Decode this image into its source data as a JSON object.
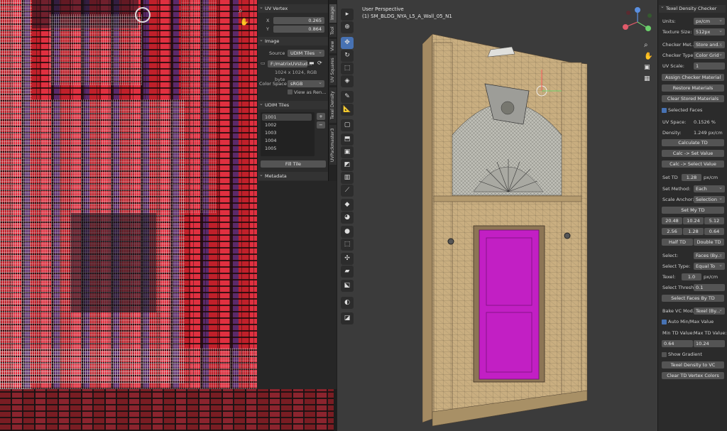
{
  "uv_editor": {
    "uv_vertex": {
      "title": "UV Vertex",
      "x_label": "X",
      "x_value": "0.265",
      "y_label": "Y",
      "y_value": "0.864"
    },
    "image": {
      "title": "Image",
      "source_label": "Source",
      "source_value": "UDIM Tiles",
      "filepath": "F:/matrixUVstud...",
      "info": "1024 x 1024,  RGB byte",
      "color_space_label": "Color Space",
      "color_space_value": "sRGB",
      "view_as_render": "View as Ren..."
    },
    "udim": {
      "title": "UDIM Tiles",
      "tiles": [
        "1001",
        "1002",
        "1003",
        "1004",
        "1005"
      ],
      "fill_tile": "Fill Tile"
    },
    "metadata_title": "Metadata",
    "tabs": [
      "Image",
      "Tool",
      "View",
      "UV Squares",
      "Texel Density",
      "UVPackmaster3"
    ]
  },
  "viewport": {
    "perspective": "User Perspective",
    "object": "(1) SM_BLDG_NYA_L5_A_Wall_05_N1",
    "tools": [
      "select",
      "cursor",
      "move",
      "rotate",
      "scale",
      "transform",
      "annotate",
      "measure",
      "add-cube",
      "extrude",
      "inset",
      "bevel",
      "loop-cut",
      "knife",
      "poly-build",
      "spin",
      "smooth",
      "edge-slide",
      "shrink",
      "shear",
      "rip",
      "to-sphere"
    ]
  },
  "texel_panel": {
    "title": "Texel Density Checker",
    "units_label": "Units:",
    "units_value": "px/cm",
    "texture_size_label": "Texture Size:",
    "texture_size_value": "512px",
    "checker_method_label": "Checker Met...",
    "checker_method_value": "Store and...",
    "checker_type_label": "Checker Type:",
    "checker_type_value": "Color Grid",
    "uv_scale_label": "UV Scale:",
    "uv_scale_value": "1",
    "assign_checker": "Assign Checker Material",
    "restore_materials": "Restore Materials",
    "clear_stored": "Clear Stored Materials",
    "selected_faces": "Selected Faces",
    "uv_space_label": "UV Space:",
    "uv_space_value": "0.1526 %",
    "density_label": "Density:",
    "density_value": "1.249 px/cm",
    "calculate_td": "Calculate TD",
    "calc_set_value": "Calc -> Set Value",
    "calc_select_value": "Calc -> Select Value",
    "set_td_label": "Set TD",
    "set_td_value": "1.28",
    "set_td_unit": "px/cm",
    "set_method_label": "Set Method:",
    "set_method_value": "Each",
    "scale_anchor_label": "Scale Anchor:",
    "scale_anchor_value": "Selection",
    "set_my_td": "Set My TD",
    "presets": [
      "20.48",
      "10.24",
      "5.12",
      "2.56",
      "1.28",
      "0.64"
    ],
    "half_td": "Half TD",
    "double_td": "Double TD",
    "select_label": "Select:",
    "select_value": "Faces (By...",
    "select_type_label": "Select Type:",
    "select_type_value": "Equal To",
    "texel_label": "Texel:",
    "texel_value": "1.0",
    "texel_unit": "px/cm",
    "select_thresh_label": "Select Thresh",
    "select_thresh_value": "0.1",
    "select_faces_by_td": "Select Faces By TD",
    "bake_vc_label": "Bake VC Mod...",
    "bake_vc_value": "Texel (By...",
    "auto_minmax": "Auto Min/Max Value",
    "min_td_label": "Min TD Value:",
    "max_td_label": "Max TD Value:",
    "min_td_value": "0.64",
    "max_td_value": "10.24",
    "show_gradient": "Show Gradient",
    "texel_to_vc": "Texel Density to VC",
    "clear_td_vc": "Clear TD Vertex Colors"
  },
  "colors": {
    "accent": "#4772b3",
    "door": "#c21fc4",
    "stone": "#c8ad7f",
    "uv_red": "#d42a3a"
  }
}
